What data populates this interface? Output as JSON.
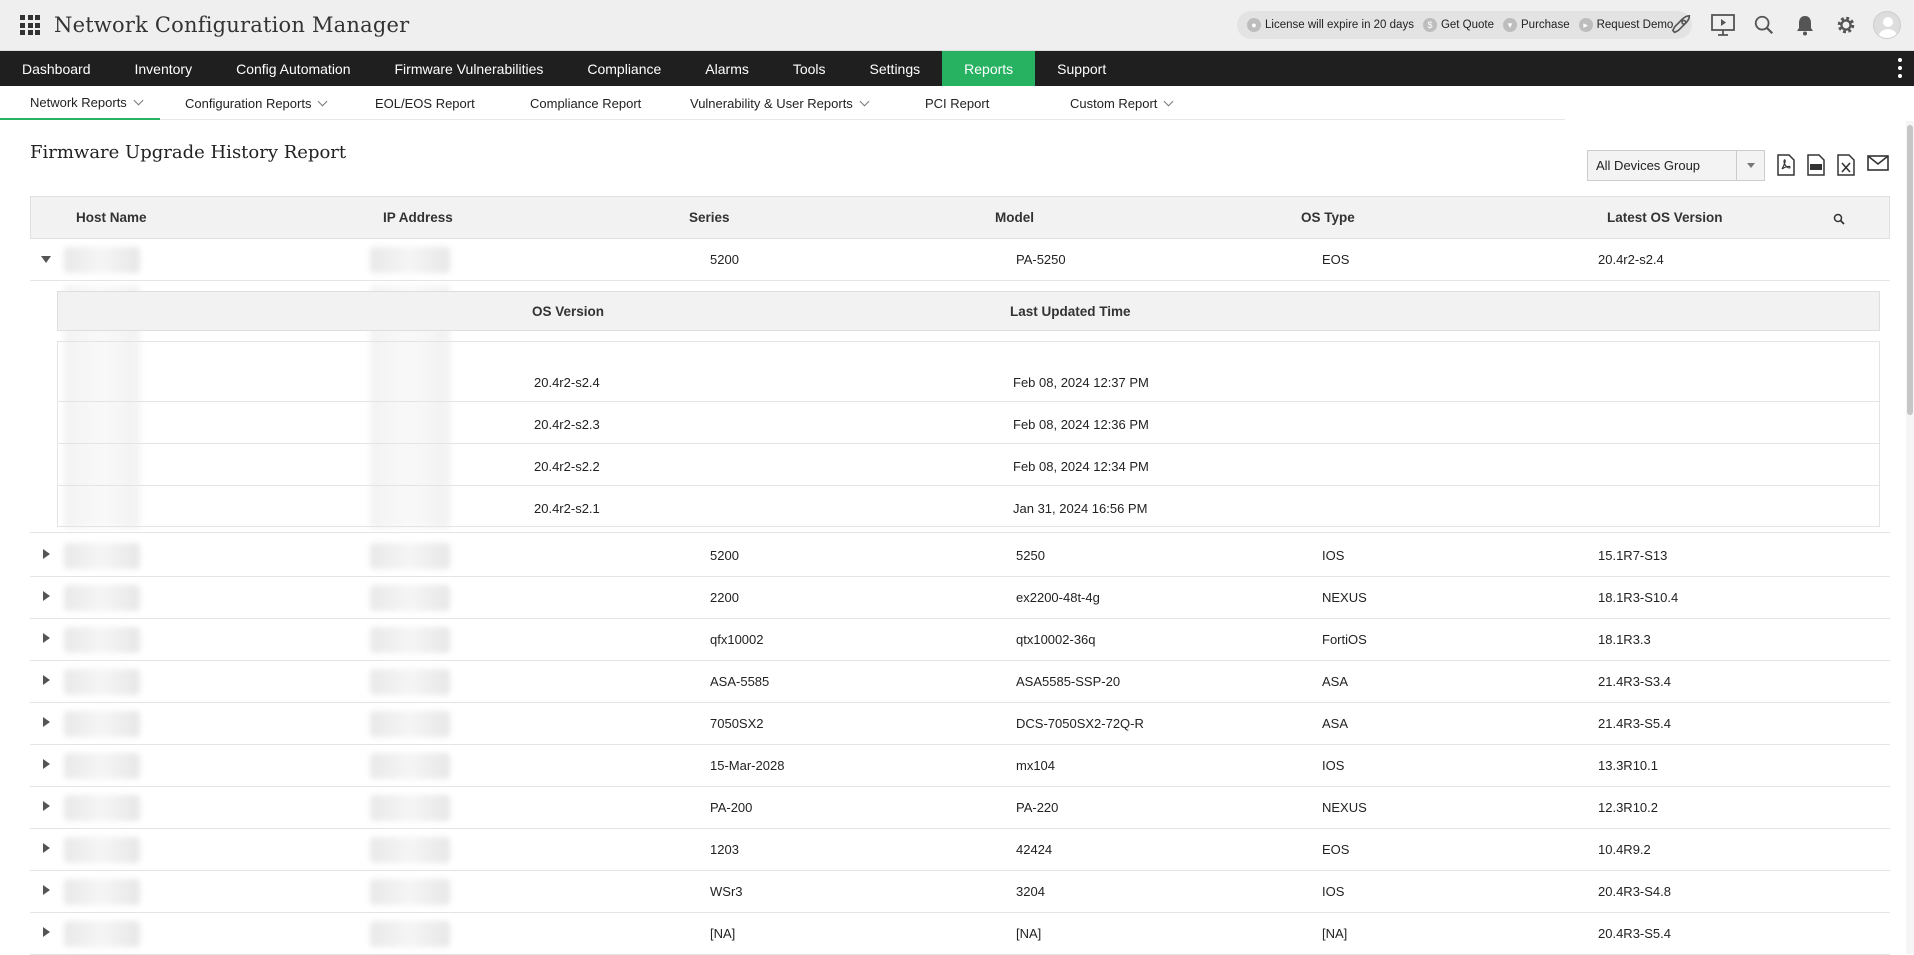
{
  "app": {
    "title": "Network Configuration Manager"
  },
  "license_bar": {
    "license": "License will expire in 20 days",
    "quote": "Get Quote",
    "purchase": "Purchase",
    "demo": "Request Demo"
  },
  "main_nav": [
    {
      "label": "Dashboard"
    },
    {
      "label": "Inventory"
    },
    {
      "label": "Config Automation"
    },
    {
      "label": "Firmware Vulnerabilities"
    },
    {
      "label": "Compliance"
    },
    {
      "label": "Alarms"
    },
    {
      "label": "Tools"
    },
    {
      "label": "Settings"
    },
    {
      "label": "Reports",
      "active": true
    },
    {
      "label": "Support"
    }
  ],
  "sub_nav": [
    {
      "label": "Network Reports",
      "dropdown": true,
      "active": true
    },
    {
      "label": "Configuration Reports",
      "dropdown": true
    },
    {
      "label": "EOL/EOS Report"
    },
    {
      "label": "Compliance Report"
    },
    {
      "label": "Vulnerability & User Reports",
      "dropdown": true
    },
    {
      "label": "PCI Report"
    },
    {
      "label": "Custom Report",
      "dropdown": true
    }
  ],
  "report": {
    "title": "Firmware Upgrade History Report",
    "group_select": "All Devices Group"
  },
  "table": {
    "columns": [
      "Host Name",
      "IP Address",
      "Series",
      "Model",
      "OS Type",
      "Latest OS Version"
    ],
    "expanded_row": {
      "series": "5200",
      "model": "PA-5250",
      "os_type": "EOS",
      "latest": "20.4r2-s2.4"
    },
    "history_columns": [
      "OS Version",
      "Last Updated Time"
    ],
    "history": [
      {
        "version": "20.4r2-s2.4",
        "time": "Feb 08, 2024 12:37 PM"
      },
      {
        "version": "20.4r2-s2.3",
        "time": "Feb 08, 2024 12:36 PM"
      },
      {
        "version": "20.4r2-s2.2",
        "time": "Feb 08, 2024 12:34 PM"
      },
      {
        "version": "20.4r2-s2.1",
        "time": "Jan 31, 2024 16:56 PM"
      }
    ],
    "rows": [
      {
        "series": "5200",
        "model": "5250",
        "os_type": "IOS",
        "latest": "15.1R7-S13"
      },
      {
        "series": "2200",
        "model": "ex2200-48t-4g",
        "os_type": "NEXUS",
        "latest": "18.1R3-S10.4"
      },
      {
        "series": "qfx10002",
        "model": "qtx10002-36q",
        "os_type": "FortiOS",
        "latest": "18.1R3.3"
      },
      {
        "series": "ASA-5585",
        "model": "ASA5585-SSP-20",
        "os_type": "ASA",
        "latest": "21.4R3-S3.4"
      },
      {
        "series": "7050SX2",
        "model": "DCS-7050SX2-72Q-R",
        "os_type": "ASA",
        "latest": "21.4R3-S5.4"
      },
      {
        "series": "15-Mar-2028",
        "model": "mx104",
        "os_type": "IOS",
        "latest": "13.3R10.1"
      },
      {
        "series": "PA-200",
        "model": "PA-220",
        "os_type": "NEXUS",
        "latest": "12.3R10.2"
      },
      {
        "series": "1203",
        "model": "42424",
        "os_type": "EOS",
        "latest": "10.4R9.2"
      },
      {
        "series": "WSr3",
        "model": "3204",
        "os_type": "IOS",
        "latest": "20.4R3-S4.8"
      },
      {
        "series": "[NA]",
        "model": "[NA]",
        "os_type": "[NA]",
        "latest": "20.4R3-S5.4"
      }
    ]
  },
  "colors": {
    "accent": "#27b262",
    "nav_bg": "#1f1f1f",
    "header_bg": "#efefef"
  },
  "icons": [
    "apps-grid-icon",
    "rocket-icon",
    "presentation-icon",
    "search-icon",
    "bell-icon",
    "gear-icon",
    "user-avatar-icon",
    "pdf-icon",
    "csv-icon",
    "excel-icon",
    "mail-icon",
    "more-vertical-icon"
  ]
}
